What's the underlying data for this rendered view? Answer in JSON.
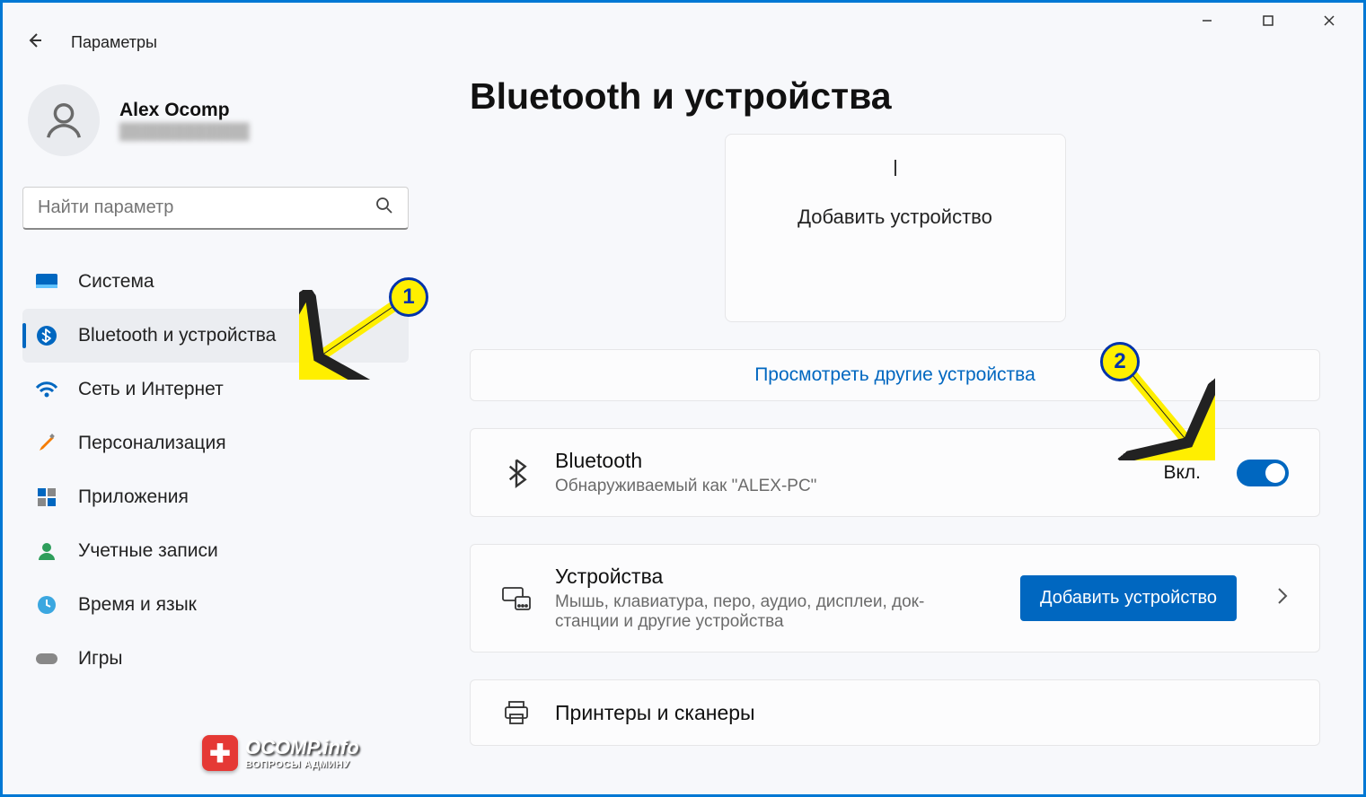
{
  "window": {
    "app_title": "Параметры"
  },
  "user": {
    "name": "Alex Ocomp",
    "email": "████████████"
  },
  "search": {
    "placeholder": "Найти параметр"
  },
  "sidebar": {
    "items": [
      {
        "label": "Система"
      },
      {
        "label": "Bluetooth и устройства"
      },
      {
        "label": "Сеть и Интернет"
      },
      {
        "label": "Персонализация"
      },
      {
        "label": "Приложения"
      },
      {
        "label": "Учетные записи"
      },
      {
        "label": "Время и язык"
      },
      {
        "label": "Игры"
      }
    ]
  },
  "page": {
    "title": "Bluetooth и устройства",
    "add_card_label": "Добавить устройство",
    "view_more": "Просмотреть другие устройства",
    "bluetooth": {
      "title": "Bluetooth",
      "subtitle": "Обнаруживаемый как \"ALEX-PC\"",
      "state_label": "Вкл."
    },
    "devices": {
      "title": "Устройства",
      "subtitle": "Мышь, клавиатура, перо, аудио, дисплеи, док-станции и другие устройства",
      "button": "Добавить устройство"
    },
    "printers": {
      "title": "Принтеры и сканеры"
    }
  },
  "annotations": {
    "callout1": "1",
    "callout2": "2"
  },
  "watermark": {
    "brand": "OCOMP",
    "tld": ".info",
    "tag": "ВОПРОСЫ АДМИНУ"
  }
}
